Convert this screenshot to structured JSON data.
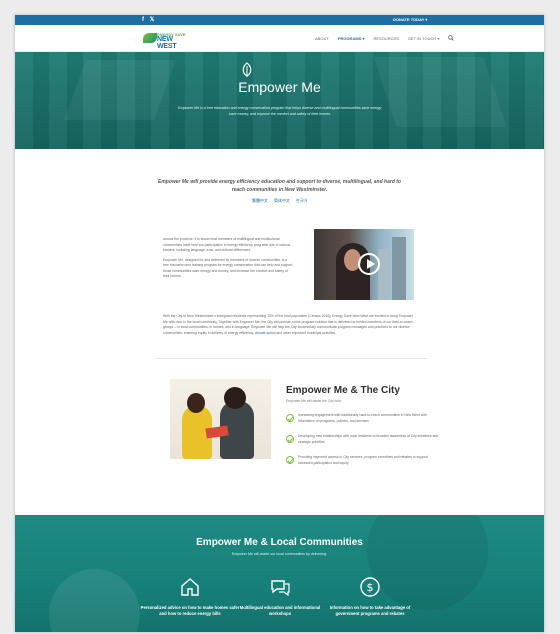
{
  "topbar": {
    "social_icons": [
      "facebook-icon",
      "twitter-icon"
    ],
    "social_glyphs": "f 𝕏",
    "donate_label": "DONATE TODAY ▾"
  },
  "nav": {
    "logo_top": "ENERGY SAVE",
    "logo_bottom": "NEW WEST",
    "items": [
      "ABOUT",
      "PROGRAMS ▾",
      "RESOURCES",
      "GET IN TOUCH ▾"
    ],
    "search_icon": "search-icon"
  },
  "hero": {
    "title": "Empower Me",
    "description": "Empower Me is a free education and energy conservation program that helps diverse and multilingual communities save energy, save money, and improve the comfort and safety of their homes."
  },
  "intro": {
    "lead": "Empower Me will provide energy efficiency education and support to diverse, multilingual, and hard to reach communities in New Westminster.",
    "languages": [
      "繁體中文",
      "简体中文",
      "한국어"
    ]
  },
  "body": {
    "p1": "Across the province, it is known that members of multilingual and multicultural communities have very low participation in energy efficiency programs due to various barriers, including language, trust, and cultural differences.",
    "p2": "Empower Me, designed for and delivered by members of diverse communities, is a free education and training program for energy conservation that can help and support those communities save energy and money, and increase the comfort and safety of their homes.",
    "p3_start": "With the City of New Westminster's immigrant residents representing 33% of the total population (Census 2016), Energy Save New West are excited to bring Empower Me with over to the local community. Together with Empower Me, the City will provide a new program solution that is delivered to trusted members of our hard-to-reach groups – in local communities, in homes, and in language. Empower Me will help the City successfully communicate program messages and practices to our diverse communities, ensuring equity in delivery of energy efficiency,",
    "p3_link": "climate action",
    "p3_end": "and other important municipal activities."
  },
  "city": {
    "title": "Empower Me & The City",
    "subtitle": "Empower Me will assist the City with:",
    "items": [
      "Increasing engagement with traditionally hard-to-reach communities in New West with information on programs, policies, and services",
      "Developing new relationships with local residents to broaden awareness of City initiatives and strategic priorities",
      "Providing improved access to City services, program incentives and rebates to support increased participation and equity"
    ]
  },
  "communities": {
    "title": "Empower Me & Local Communities",
    "subtitle": "Empower Me will assist our local communities by delivering:",
    "features": [
      {
        "icon": "home-icon",
        "glyph": "⌂",
        "label": "Personalized advice on how to make homes safer and how to reduce energy bills"
      },
      {
        "icon": "chat-icon",
        "glyph": "💬",
        "label": "Multilingual education and informational workshops"
      },
      {
        "icon": "dollar-icon",
        "glyph": "$",
        "label": "Information on how to take advantage of government programs and rebates"
      }
    ]
  },
  "colors": {
    "brand_blue": "#1d6fa3",
    "teal": "#1a6f69",
    "green": "#7cc143"
  }
}
